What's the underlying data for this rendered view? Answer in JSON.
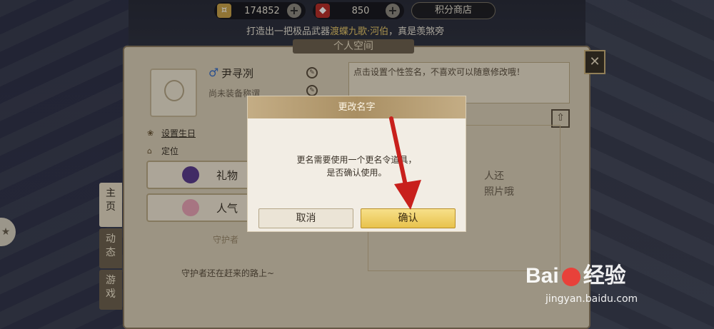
{
  "topbar": {
    "gold_amount": "174852",
    "gem_amount": "850",
    "plus": "+",
    "shop_label": "积分商店"
  },
  "marquee": {
    "prefix": "打造出一把极品武器",
    "highlight": "渡蝶九歌·河伯",
    "suffix": "，真是羡煞旁"
  },
  "panel": {
    "title": "个人空间",
    "close": "✕"
  },
  "profile": {
    "gender_symbol": "♂",
    "name": "尹寻冽",
    "sub_status": "尚未装备称谓",
    "set_birthday": "设置生日",
    "location": "定位"
  },
  "actions": {
    "gift": "礼物",
    "popularity": "人气"
  },
  "guardian": {
    "title": "守护者",
    "empty_text": "守护者还在赶来的路上~"
  },
  "signature": {
    "placeholder": "点击设置个性签名，不喜欢可以随意修改哦！"
  },
  "photo": {
    "line1": "人还",
    "line2": "照片哦"
  },
  "vtabs": [
    {
      "label": "主\n页"
    },
    {
      "label": "动\n态"
    },
    {
      "label": "游\n戏"
    }
  ],
  "modal": {
    "title": "更改名字",
    "message_line1": "更名需要使用一个更名令道具，",
    "message_line2": "是否确认使用。",
    "cancel": "取消",
    "confirm": "确认"
  },
  "watermark": {
    "brand_left": "Bai",
    "brand_right": "经验",
    "url": "jingyan.baidu.com"
  },
  "colors": {
    "arrow": "#c8201c",
    "confirm_button": "#f0d060",
    "panel_bg": "#d9cdb6"
  }
}
